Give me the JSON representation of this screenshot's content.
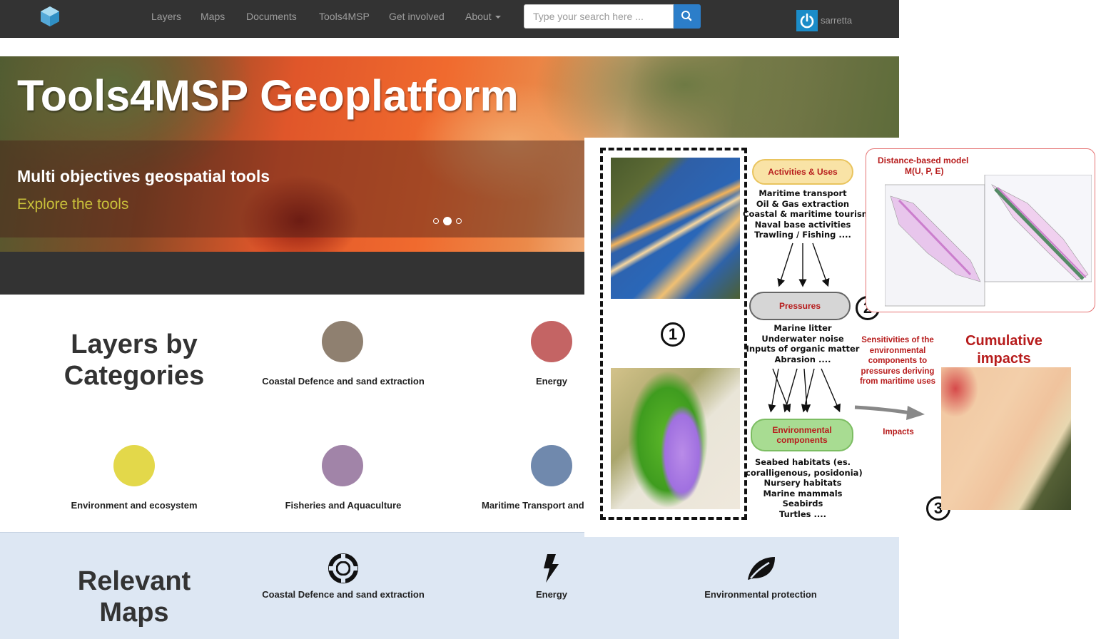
{
  "nav": {
    "items": [
      "Layers",
      "Maps",
      "Documents",
      "Tools4MSP",
      "Get involved",
      "About"
    ],
    "search_placeholder": "Type your search here ...",
    "user": "sarretta"
  },
  "hero": {
    "title": "Tools4MSP Geoplatform",
    "subtitle": "Multi objectives geospatial tools",
    "link": "Explore the tools",
    "carousel_active_index": 1,
    "carousel_count": 3
  },
  "categories": {
    "title": "Layers by Categories",
    "items": [
      {
        "label": "Coastal Defence and sand extraction",
        "color": "#8f8070"
      },
      {
        "label": "Energy",
        "color": "#c46464"
      },
      {
        "label": "Environment and ecosystem",
        "color": "#e3d84a"
      },
      {
        "label": "Fisheries and Aquaculture",
        "color": "#a184a8"
      },
      {
        "label": "Maritime Transport and",
        "color": "#7089ad"
      }
    ]
  },
  "maps": {
    "title": "Relevant Maps",
    "items": [
      {
        "label": "Coastal Defence and sand extraction",
        "icon": "life-ring-icon"
      },
      {
        "label": "Energy",
        "icon": "lightning-bolt-icon"
      },
      {
        "label": "Environmental protection",
        "icon": "leaf-icon"
      }
    ]
  },
  "figure": {
    "step_numbers": [
      "1",
      "2",
      "3"
    ],
    "activities_label": "Activities & Uses",
    "activities": [
      "Maritime transport",
      "Oil & Gas extraction",
      "Coastal & maritime tourism",
      "Naval base activities",
      "Trawling / Fishing ...."
    ],
    "pressures_label": "Pressures",
    "pressures": [
      "Marine litter",
      "Underwater noise",
      "Inputs of organic matter",
      "Abrasion ...."
    ],
    "env_label": "Environmental components",
    "env_components": [
      "Seabed habitats (es.",
      "coralligenous, posidonia)",
      "Nursery habitats",
      "Marine mammals",
      "Seabirds",
      "Turtles ...."
    ],
    "model_title": "Distance-based model",
    "model_formula": "M(U, P, E)",
    "sensitivities": "Sensitivities of the environmental components to pressures deriving from maritime uses",
    "impacts": "Impacts",
    "cumulative": "Cumulative impacts",
    "colors": {
      "accent_red": "#b71c1c",
      "activities_fill": "#f9e3a6",
      "pressures_fill": "#d6d6d6",
      "env_fill": "#a8dc92"
    }
  }
}
